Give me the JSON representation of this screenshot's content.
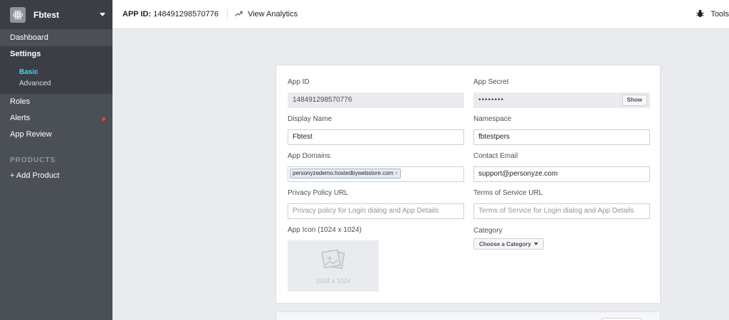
{
  "sidebar": {
    "app_name": "Fbtest",
    "nav": {
      "dashboard": "Dashboard",
      "settings": "Settings",
      "settings_sub": [
        "Basic",
        "Advanced"
      ],
      "roles": "Roles",
      "alerts": "Alerts",
      "app_review": "App Review"
    },
    "products_heading": "PRODUCTS",
    "add_product": "+ Add Product"
  },
  "topbar": {
    "app_id_label": "APP ID:",
    "app_id_value": "148491298570776",
    "view_analytics": "View Analytics",
    "tools": "Tools"
  },
  "form": {
    "app_id": {
      "label": "App ID",
      "value": "148491298570776"
    },
    "app_secret": {
      "label": "App Secret",
      "value": "••••••••",
      "show_label": "Show"
    },
    "display_name": {
      "label": "Display Name",
      "value": "Fbtest"
    },
    "namespace": {
      "label": "Namespace",
      "value": "fbtestpers"
    },
    "app_domains": {
      "label": "App Domains",
      "tags": [
        "personyzedemo.hostedbywebstore.com"
      ]
    },
    "contact_email": {
      "label": "Contact Email",
      "value": "support@personyze.com"
    },
    "privacy_policy": {
      "label": "Privacy Policy URL",
      "placeholder": "Privacy policy for Login dialog and App Details"
    },
    "terms_of_service": {
      "label": "Terms of Service URL",
      "placeholder": "Terms of Service for Login dialog and App Details"
    },
    "app_icon": {
      "label": "App Icon (1024 x 1024)",
      "size_text": "1024 x 1024"
    },
    "category": {
      "label": "Category",
      "button": "Choose a Category"
    }
  },
  "colors": {
    "sidebar_bg": "#4b4f56",
    "active_sub": "#4fd0e6",
    "alert_dot": "#fa3e3e",
    "page_bg": "#e9ebee"
  }
}
